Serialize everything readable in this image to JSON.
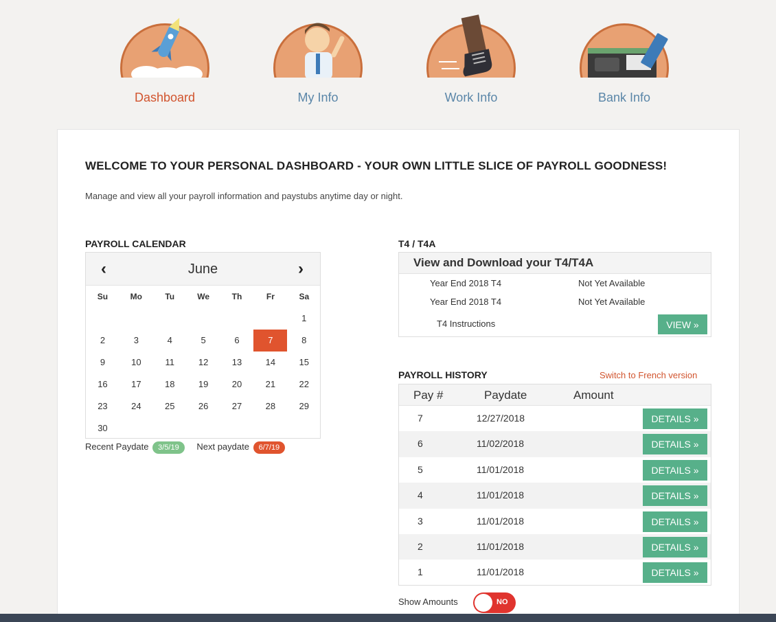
{
  "nav": [
    {
      "label": "Dashboard",
      "icon": "rocket-icon",
      "active": true
    },
    {
      "label": "My Info",
      "icon": "person-waving-icon",
      "active": false
    },
    {
      "label": "Work Info",
      "icon": "boot-icon",
      "active": false
    },
    {
      "label": "Bank Info",
      "icon": "wallet-card-icon",
      "active": false
    }
  ],
  "welcome": "WELCOME TO YOUR PERSONAL DASHBOARD - YOUR OWN LITTLE SLICE OF PAYROLL GOODNESS!",
  "subtitle": "Manage and view all your payroll information and paystubs anytime day or night.",
  "calendar": {
    "title": "PAYROLL CALENDAR",
    "month": "June",
    "prev": "‹",
    "next": "›",
    "dow": [
      "Su",
      "Mo",
      "Tu",
      "We",
      "Th",
      "Fr",
      "Sa"
    ],
    "leading_blanks": 6,
    "days": [
      "1",
      "2",
      "3",
      "4",
      "5",
      "6",
      "7",
      "8",
      "9",
      "10",
      "11",
      "12",
      "13",
      "14",
      "15",
      "16",
      "17",
      "18",
      "19",
      "20",
      "21",
      "22",
      "23",
      "24",
      "25",
      "26",
      "27",
      "28",
      "29",
      "30"
    ],
    "selected_day": "7",
    "recent_label": "Recent Paydate",
    "recent_value": "3/5/19",
    "next_label": "Next paydate",
    "next_value": "6/7/19"
  },
  "t4": {
    "title": "T4 / T4A",
    "header": "View and Download your T4/T4A",
    "rows": [
      {
        "label": "Year End 2018 T4",
        "status": "Not Yet Available"
      },
      {
        "label": "Year End 2018 T4",
        "status": "Not Yet Available"
      }
    ],
    "instructions": "T4 Instructions",
    "view_button": "VIEW »"
  },
  "history": {
    "title": "PAYROLL HISTORY",
    "french_link": "Switch to French version",
    "columns": [
      "Pay #",
      "Paydate",
      "Amount"
    ],
    "rows": [
      {
        "pay": "7",
        "date": "12/27/2018"
      },
      {
        "pay": "6",
        "date": "11/02/2018"
      },
      {
        "pay": "5",
        "date": "11/01/2018"
      },
      {
        "pay": "4",
        "date": "11/01/2018"
      },
      {
        "pay": "3",
        "date": "11/01/2018"
      },
      {
        "pay": "2",
        "date": "11/01/2018"
      },
      {
        "pay": "1",
        "date": "11/01/2018"
      }
    ],
    "details_label": "DETAILS »"
  },
  "show_amounts": {
    "label": "Show Amounts",
    "toggle": "NO"
  },
  "colors": {
    "accent": "#e0542e",
    "green": "#57b08a",
    "link": "#5a86a8"
  }
}
